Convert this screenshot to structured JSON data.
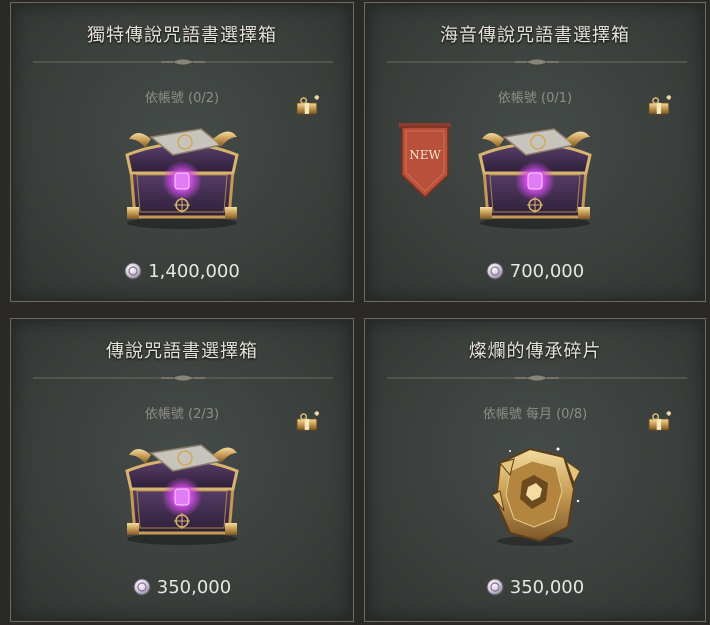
{
  "cards": [
    {
      "title": "獨特傳說咒語書選擇箱",
      "limit": "依帳號 (0/2)",
      "price": "1,400,000",
      "item_icon": "legendary-chest-icon",
      "new": false
    },
    {
      "title": "海音傳說咒語書選擇箱",
      "limit": "依帳號 (0/1)",
      "price": "700,000",
      "item_icon": "legendary-chest-icon",
      "new": true,
      "new_label": "NEW"
    },
    {
      "title": "傳說咒語書選擇箱",
      "limit": "依帳號 (2/3)",
      "price": "350,000",
      "item_icon": "legendary-chest-icon",
      "new": false
    },
    {
      "title": "燦爛的傳承碎片",
      "limit": "依帳號 每月 (0/8)",
      "price": "350,000",
      "item_icon": "golden-fragment-icon",
      "new": false
    }
  ],
  "colors": {
    "title": "#e6e2d8",
    "limit": "#8f8e84",
    "price": "#e8e6e0",
    "banner": "#b9503a",
    "chest_glow": "#d84cf0"
  }
}
